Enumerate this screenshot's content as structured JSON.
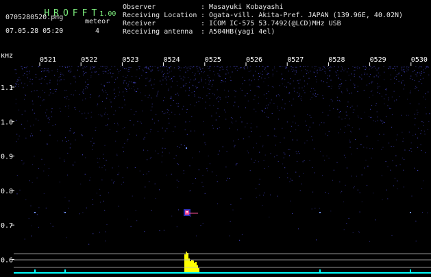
{
  "app": {
    "name": "HROFFT",
    "version": "1.00"
  },
  "file": {
    "name": "0705280520.png",
    "datetime": "07.05.28 05:20"
  },
  "meteor": {
    "label": "meteor",
    "count": "4"
  },
  "info": [
    {
      "label": "Observer",
      "value": ": Masayuki Kobayashi"
    },
    {
      "label": "Receiving Location",
      "value": ": Ogata-vill. Akita-Pref. JAPAN (139.96E, 40.02N)"
    },
    {
      "label": "Receiver",
      "value": ": ICOM IC-575 53.7492(@LCD)MHz USB"
    },
    {
      "label": "Receiving antenna",
      "value": ": A504HB(yagi 4el)"
    }
  ],
  "chart_data": {
    "type": "heatmap",
    "yunit": "kHz",
    "time_ticks": [
      "0521",
      "0522",
      "0523",
      "0524",
      "0525",
      "0526",
      "0527",
      "0528",
      "0529",
      "0530"
    ],
    "freq_ticks": [
      "1.1",
      "1.0",
      "0.9",
      "0.8",
      "0.7",
      "0.6"
    ],
    "freq_tick_values": [
      1.1,
      1.0,
      0.9,
      0.8,
      0.7,
      0.6
    ],
    "colors": {
      "axis": "#ffffff",
      "noise": "#3a3aff",
      "echo": "#ff4f9a",
      "bars": "#ffff00",
      "baseline": "#00ffff"
    }
  }
}
